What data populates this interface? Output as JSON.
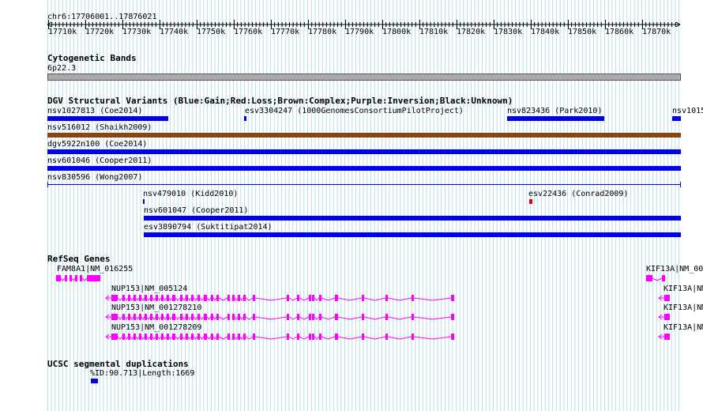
{
  "region": "chr6:17706001..17876021",
  "ruler": {
    "ticks": [
      "17710k",
      "17720k",
      "17730k",
      "17740k",
      "17750k",
      "17760k",
      "17770k",
      "17780k",
      "17790k",
      "17800k",
      "17810k",
      "17820k",
      "17830k",
      "17840k",
      "17850k",
      "17860k",
      "17870k"
    ]
  },
  "cytobands": {
    "title": "Cytogenetic Bands",
    "band": "6p22.3"
  },
  "dgv": {
    "title": "DGV Structural Variants (Blue:Gain;Red:Loss;Brown:Complex;Purple:Inversion;Black:Unknown)",
    "features": [
      {
        "label": "nsv1027813 (Coe2014)"
      },
      {
        "label": "esv3304247 (1000GenomesConsortiumPilotProject)"
      },
      {
        "label": "nsv823436 (Park2010)"
      },
      {
        "label": "nsv1015"
      },
      {
        "label": "nsv516012 (Shaikh2009)"
      },
      {
        "label": "dgv5922n100 (Coe2014)"
      },
      {
        "label": "nsv601046 (Cooper2011)"
      },
      {
        "label": "nsv830596 (Wong2007)"
      },
      {
        "label": "nsv479010 (Kidd2010)"
      },
      {
        "label": "esv22436 (Conrad2009)"
      },
      {
        "label": "nsv601047 (Cooper2011)"
      },
      {
        "label": "esv3890794 (Suktitipat2014)"
      }
    ]
  },
  "refseq": {
    "title": "RefSeq Genes",
    "genes": [
      {
        "label": "FAM8A1|NM_016255"
      },
      {
        "label": "KIF13A|NM_00"
      },
      {
        "label": "NUP153|NM_005124"
      },
      {
        "label": "KIF13A|NM"
      },
      {
        "label": "NUP153|NM_001278210"
      },
      {
        "label": "KIF13A|NM"
      },
      {
        "label": "NUP153|NM_001278209"
      },
      {
        "label": "KIF13A|NM"
      }
    ]
  },
  "segdups": {
    "title": "UCSC segmental duplications",
    "feature": "%ID:90.713|Length:1669"
  },
  "colors": {
    "gain": "#0000ee",
    "loss": "#ee0000",
    "complex": "#8b4513",
    "gene": "#ff00ff",
    "grid": "#b8dde8"
  }
}
